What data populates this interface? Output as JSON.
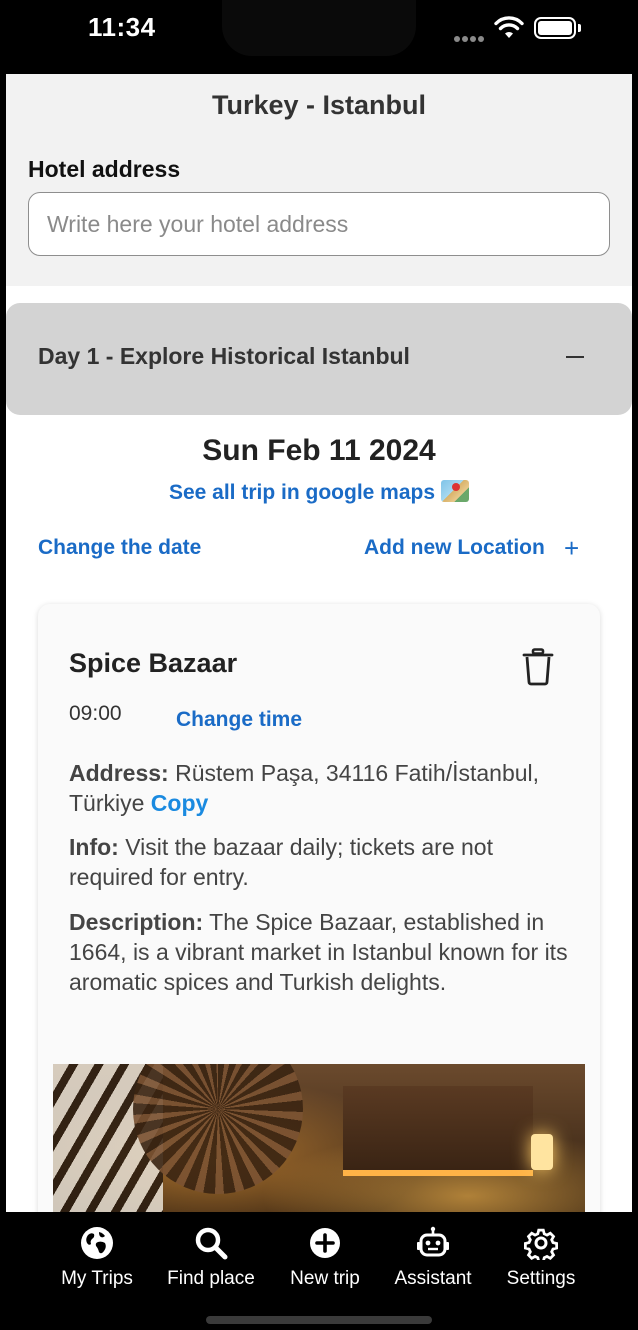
{
  "status_bar": {
    "time": "11:34"
  },
  "header": {
    "title": "Turkey - Istanbul"
  },
  "hotel": {
    "label": "Hotel address",
    "placeholder": "Write here your hotel address",
    "value": ""
  },
  "day": {
    "title": "Day 1 - Explore Historical Istanbul",
    "date": "Sun Feb 11 2024",
    "maps_link": "See all trip in google maps",
    "change_date": "Change the date",
    "add_location": "Add new Location"
  },
  "location": {
    "name": "Spice Bazaar",
    "time": "09:00",
    "change_time": "Change time",
    "address_label": "Address:",
    "address": "Rüstem Paşa, 34116 Fatih/İstanbul, Türkiye",
    "copy_label": "Copy",
    "info_label": "Info:",
    "info": "Visit the bazaar daily; tickets are not required for entry.",
    "description_label": "Description:",
    "description": "The Spice Bazaar, established in 1664, is a vibrant market in Istanbul known for its aromatic spices and Turkish delights."
  },
  "tabs": [
    {
      "label": "My Trips",
      "icon": "globe-icon"
    },
    {
      "label": "Find place",
      "icon": "search-icon"
    },
    {
      "label": "New trip",
      "icon": "plus-circle-icon"
    },
    {
      "label": "Assistant",
      "icon": "robot-icon"
    },
    {
      "label": "Settings",
      "icon": "gear-icon"
    }
  ],
  "colors": {
    "link": "#1a6bc6",
    "copy": "#1a8ae0",
    "day_header": "#d3d3d3"
  }
}
